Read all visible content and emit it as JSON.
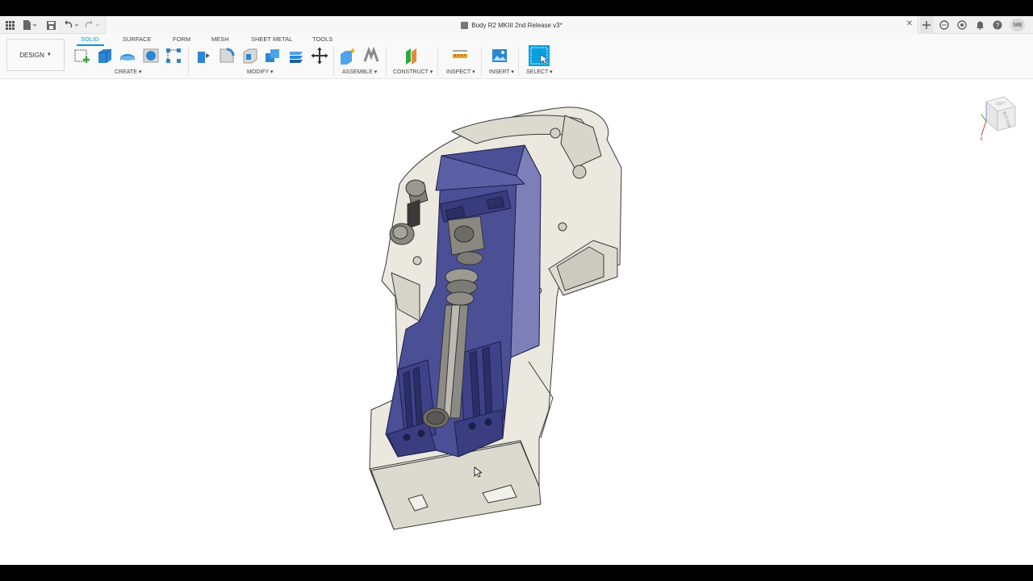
{
  "app": {
    "document_title": "Body R2 MKIII 2nd Release v3*",
    "user_initials": "MB"
  },
  "workspace": {
    "label": "DESIGN"
  },
  "tabs": [
    {
      "label": "SOLID",
      "active": true
    },
    {
      "label": "SURFACE",
      "active": false
    },
    {
      "label": "FORM",
      "active": false
    },
    {
      "label": "MESH",
      "active": false
    },
    {
      "label": "SHEET METAL",
      "active": false
    },
    {
      "label": "TOOLS",
      "active": false
    }
  ],
  "groups": {
    "create": "CREATE",
    "modify": "MODIFY",
    "assemble": "ASSEMBLE",
    "construct": "CONSTRUCT",
    "inspect": "INSPECT",
    "insert": "INSERT",
    "select": "SELECT"
  },
  "viewcube": {
    "top_label": "LEFT",
    "front_label": "BOTTOM"
  },
  "colors": {
    "accent": "#0696d7",
    "body": "#e9e6dd",
    "component": "#4a4f96"
  },
  "icons": [
    "apps-grid-icon",
    "file-icon",
    "save-icon",
    "undo-icon",
    "redo-icon",
    "new-tab-icon",
    "online-status-icon",
    "job-status-icon",
    "notifications-icon",
    "help-icon"
  ]
}
